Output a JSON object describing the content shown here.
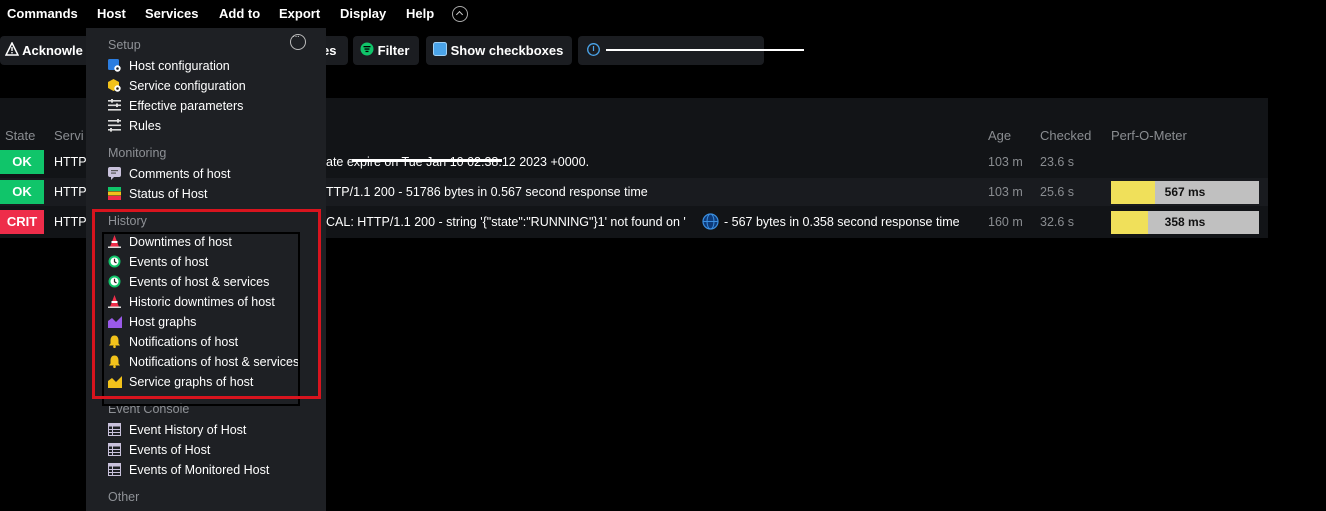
{
  "menubar": {
    "items": [
      "Commands",
      "Host",
      "Services",
      "Add to",
      "Export",
      "Display",
      "Help"
    ]
  },
  "toolbar": {
    "acknowledge_label": "Acknowle",
    "partial_label": "es",
    "filter_label": "Filter",
    "checkboxes_label": "Show checkboxes"
  },
  "table": {
    "headers": {
      "state": "State",
      "service": "Servi",
      "age": "Age",
      "checked": "Checked",
      "perf": "Perf-O-Meter"
    },
    "rows": [
      {
        "state": "OK",
        "service": "HTTP",
        "output": "ate                              expire on Tue Jan 10 02:38:12 2023 +0000.",
        "age": "103 m",
        "checked": "23.6 s",
        "perf": null
      },
      {
        "state": "OK",
        "service": "HTTP",
        "output": "TTP/1.1 200 - 51786 bytes in 0.567 second response time",
        "age": "103 m",
        "checked": "25.6 s",
        "perf": {
          "label": "567 ms",
          "fraction": 0.3
        }
      },
      {
        "state": "CRIT",
        "service": "HTTP",
        "output_a": "CAL: HTTP/1.1 200 - string '{\"state\":\"RUNNING\"}1' not found on '",
        "output_b": "- 567 bytes in 0.358 second response time",
        "age": "160 m",
        "checked": "32.6 s",
        "perf": {
          "label": "358 ms",
          "fraction": 0.25
        }
      }
    ]
  },
  "dropdown": {
    "sections": {
      "setup": "Setup",
      "monitoring": "Monitoring",
      "history": "History",
      "event_console": "Event Console",
      "other": "Other"
    },
    "setup_items": [
      "Host configuration",
      "Service configuration",
      "Effective parameters",
      "Rules"
    ],
    "monitoring_items": [
      "Comments of host",
      "Status of Host"
    ],
    "history_items": [
      "Downtimes of host",
      "Events of host",
      "Events of host & services",
      "Historic downtimes of host",
      "Host graphs",
      "Notifications of host",
      "Notifications of host & services",
      "Service graphs of host"
    ],
    "event_console_items": [
      "Event History of Host",
      "Events of Host",
      "Events of Monitored Host"
    ]
  },
  "colors": {
    "ok": "#10c56a",
    "crit": "#ee2d4a",
    "highlight": "#d8141e",
    "perf_fill": "#f0e05a"
  }
}
